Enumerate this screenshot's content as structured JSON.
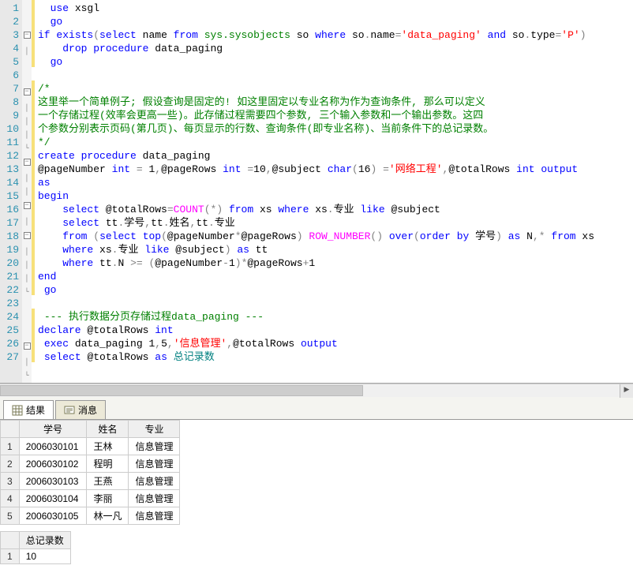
{
  "editor": {
    "lines": [
      {
        "n": 1,
        "fold": "",
        "mark": "y",
        "tokens": [
          [
            "",
            "  "
          ],
          [
            "kw",
            "use"
          ],
          [
            "",
            " xsgl"
          ]
        ]
      },
      {
        "n": 2,
        "fold": "",
        "mark": "y",
        "tokens": [
          [
            "",
            "  "
          ],
          [
            "kw",
            "go"
          ]
        ]
      },
      {
        "n": 3,
        "fold": "box",
        "mark": "y",
        "tokens": [
          [
            "kw",
            "if"
          ],
          [
            "",
            " "
          ],
          [
            "kw",
            "exists"
          ],
          [
            "op",
            "("
          ],
          [
            "kw",
            "select"
          ],
          [
            "",
            " name "
          ],
          [
            "kw",
            "from"
          ],
          [
            "",
            " "
          ],
          [
            "sys",
            "sys.sysobjects"
          ],
          [
            "",
            " so "
          ],
          [
            "kw",
            "where"
          ],
          [
            "",
            " so"
          ],
          [
            "op",
            "."
          ],
          [
            "",
            "name"
          ],
          [
            "op",
            "="
          ],
          [
            "str",
            "'data_paging'"
          ],
          [
            "",
            " "
          ],
          [
            "kw",
            "and"
          ],
          [
            "",
            " so"
          ],
          [
            "op",
            "."
          ],
          [
            "",
            "type"
          ],
          [
            "op",
            "="
          ],
          [
            "str",
            "'P'"
          ],
          [
            "op",
            ")"
          ]
        ]
      },
      {
        "n": 4,
        "fold": "bar",
        "mark": "y",
        "tokens": [
          [
            "",
            "    "
          ],
          [
            "kw",
            "drop"
          ],
          [
            "",
            " "
          ],
          [
            "kw",
            "procedure"
          ],
          [
            "",
            " data_paging"
          ]
        ]
      },
      {
        "n": 5,
        "fold": "",
        "mark": "y",
        "tokens": [
          [
            "",
            "  "
          ],
          [
            "kw",
            "go"
          ]
        ]
      },
      {
        "n": 6,
        "fold": "",
        "mark": "",
        "tokens": [
          [
            "",
            ""
          ]
        ]
      },
      {
        "n": 7,
        "fold": "box",
        "mark": "y",
        "tokens": [
          [
            "cmt",
            "/*"
          ]
        ]
      },
      {
        "n": 8,
        "fold": "bar",
        "mark": "y",
        "tokens": [
          [
            "cmt",
            "这里举一个简单例子; 假设查询是固定的! 如这里固定以专业名称为作为查询条件, 那么可以定义"
          ]
        ]
      },
      {
        "n": 9,
        "fold": "bar",
        "mark": "y",
        "tokens": [
          [
            "cmt",
            "一个存储过程(效率会更高一些)。此存储过程需要四个参数, 三个输入参数和一个输出参数。这四"
          ]
        ]
      },
      {
        "n": 10,
        "fold": "bar",
        "mark": "y",
        "tokens": [
          [
            "cmt",
            "个参数分别表示页码(第几页)、每页显示的行数、查询条件(即专业名称)、当前条件下的总记录数。"
          ]
        ]
      },
      {
        "n": 11,
        "fold": "end",
        "mark": "y",
        "tokens": [
          [
            "cmt",
            "*/"
          ]
        ]
      },
      {
        "n": 12,
        "fold": "box",
        "mark": "y",
        "tokens": [
          [
            "kw",
            "create"
          ],
          [
            "",
            " "
          ],
          [
            "kw",
            "procedure"
          ],
          [
            "",
            " data_paging"
          ]
        ]
      },
      {
        "n": 13,
        "fold": "bar",
        "mark": "y",
        "tokens": [
          [
            "var",
            "@pageNumber"
          ],
          [
            "",
            " "
          ],
          [
            "kw",
            "int"
          ],
          [
            "",
            " "
          ],
          [
            "op",
            "="
          ],
          [
            "",
            " 1"
          ],
          [
            "op",
            ","
          ],
          [
            "var",
            "@pageRows"
          ],
          [
            "",
            " "
          ],
          [
            "kw",
            "int"
          ],
          [
            "",
            " "
          ],
          [
            "op",
            "="
          ],
          [
            "",
            "10"
          ],
          [
            "op",
            ","
          ],
          [
            "var",
            "@subject"
          ],
          [
            "",
            " "
          ],
          [
            "kw",
            "char"
          ],
          [
            "op",
            "("
          ],
          [
            "",
            "16"
          ],
          [
            "op",
            ")"
          ],
          [
            "",
            " "
          ],
          [
            "op",
            "="
          ],
          [
            "str",
            "'网络工程'"
          ],
          [
            "op",
            ","
          ],
          [
            "var",
            "@totalRows"
          ],
          [
            "",
            " "
          ],
          [
            "kw",
            "int"
          ],
          [
            "",
            " "
          ],
          [
            "kw",
            "output"
          ]
        ]
      },
      {
        "n": 14,
        "fold": "bar",
        "mark": "y",
        "tokens": [
          [
            "kw",
            "as"
          ]
        ]
      },
      {
        "n": 15,
        "fold": "box",
        "mark": "y",
        "tokens": [
          [
            "kw",
            "begin"
          ]
        ]
      },
      {
        "n": 16,
        "fold": "bar",
        "mark": "y",
        "tokens": [
          [
            "",
            "    "
          ],
          [
            "kw",
            "select"
          ],
          [
            "",
            " "
          ],
          [
            "var",
            "@totalRows"
          ],
          [
            "op",
            "="
          ],
          [
            "fn",
            "COUNT"
          ],
          [
            "op",
            "("
          ],
          [
            "op",
            "*"
          ],
          [
            "op",
            ")"
          ],
          [
            "",
            " "
          ],
          [
            "kw",
            "from"
          ],
          [
            "",
            " xs "
          ],
          [
            "kw",
            "where"
          ],
          [
            "",
            " xs"
          ],
          [
            "op",
            "."
          ],
          [
            "",
            "专业 "
          ],
          [
            "kw",
            "like"
          ],
          [
            "",
            " "
          ],
          [
            "var",
            "@subject"
          ]
        ]
      },
      {
        "n": 17,
        "fold": "box",
        "mark": "y",
        "tokens": [
          [
            "",
            "    "
          ],
          [
            "kw",
            "select"
          ],
          [
            "",
            " tt"
          ],
          [
            "op",
            "."
          ],
          [
            "",
            "学号"
          ],
          [
            "op",
            ","
          ],
          [
            "",
            "tt"
          ],
          [
            "op",
            "."
          ],
          [
            "",
            "姓名"
          ],
          [
            "op",
            ","
          ],
          [
            "",
            "tt"
          ],
          [
            "op",
            "."
          ],
          [
            "",
            "专业"
          ]
        ]
      },
      {
        "n": 18,
        "fold": "bar",
        "mark": "y",
        "tokens": [
          [
            "",
            "    "
          ],
          [
            "kw",
            "from"
          ],
          [
            "",
            " "
          ],
          [
            "op",
            "("
          ],
          [
            "kw",
            "select"
          ],
          [
            "",
            " "
          ],
          [
            "kw",
            "top"
          ],
          [
            "op",
            "("
          ],
          [
            "var",
            "@pageNumber"
          ],
          [
            "op",
            "*"
          ],
          [
            "var",
            "@pageRows"
          ],
          [
            "op",
            ")"
          ],
          [
            "",
            " "
          ],
          [
            "fn",
            "ROW_NUMBER"
          ],
          [
            "op",
            "()"
          ],
          [
            "",
            " "
          ],
          [
            "kw",
            "over"
          ],
          [
            "op",
            "("
          ],
          [
            "kw",
            "order"
          ],
          [
            "",
            " "
          ],
          [
            "kw",
            "by"
          ],
          [
            "",
            " 学号"
          ],
          [
            "op",
            ")"
          ],
          [
            "",
            " "
          ],
          [
            "kw",
            "as"
          ],
          [
            "",
            " N"
          ],
          [
            "op",
            ","
          ],
          [
            "op",
            "*"
          ],
          [
            "",
            " "
          ],
          [
            "kw",
            "from"
          ],
          [
            "",
            " xs"
          ]
        ]
      },
      {
        "n": 19,
        "fold": "bar",
        "mark": "y",
        "tokens": [
          [
            "",
            "    "
          ],
          [
            "kw",
            "where"
          ],
          [
            "",
            " xs"
          ],
          [
            "op",
            "."
          ],
          [
            "",
            "专业 "
          ],
          [
            "kw",
            "like"
          ],
          [
            "",
            " "
          ],
          [
            "var",
            "@subject"
          ],
          [
            "op",
            ")"
          ],
          [
            "",
            " "
          ],
          [
            "kw",
            "as"
          ],
          [
            "",
            " tt"
          ]
        ]
      },
      {
        "n": 20,
        "fold": "bar",
        "mark": "y",
        "tokens": [
          [
            "",
            "    "
          ],
          [
            "kw",
            "where"
          ],
          [
            "",
            " tt"
          ],
          [
            "op",
            "."
          ],
          [
            "",
            "N "
          ],
          [
            "op",
            ">="
          ],
          [
            "",
            " "
          ],
          [
            "op",
            "("
          ],
          [
            "var",
            "@pageNumber"
          ],
          [
            "op",
            "-"
          ],
          [
            "",
            "1"
          ],
          [
            "op",
            ")"
          ],
          [
            "op",
            "*"
          ],
          [
            "var",
            "@pageRows"
          ],
          [
            "op",
            "+"
          ],
          [
            "",
            "1"
          ]
        ]
      },
      {
        "n": 21,
        "fold": "end",
        "mark": "y",
        "tokens": [
          [
            "kw",
            "end"
          ]
        ]
      },
      {
        "n": 22,
        "fold": "",
        "mark": "y",
        "tokens": [
          [
            "",
            " "
          ],
          [
            "kw",
            "go"
          ]
        ]
      },
      {
        "n": 23,
        "fold": "",
        "mark": "",
        "tokens": [
          [
            "",
            ""
          ]
        ]
      },
      {
        "n": 24,
        "fold": "",
        "mark": "y",
        "tokens": [
          [
            "",
            " "
          ],
          [
            "cmt",
            "--- 执行数据分页存储过程data_paging ---"
          ]
        ]
      },
      {
        "n": 25,
        "fold": "box",
        "mark": "y",
        "tokens": [
          [
            "kw",
            "declare"
          ],
          [
            "",
            " "
          ],
          [
            "var",
            "@totalRows"
          ],
          [
            "",
            " "
          ],
          [
            "kw",
            "int"
          ]
        ]
      },
      {
        "n": 26,
        "fold": "bar",
        "mark": "y",
        "tokens": [
          [
            "",
            " "
          ],
          [
            "kw",
            "exec"
          ],
          [
            "",
            " data_paging 1"
          ],
          [
            "op",
            ","
          ],
          [
            "",
            "5"
          ],
          [
            "op",
            ","
          ],
          [
            "str",
            "'信息管理'"
          ],
          [
            "op",
            ","
          ],
          [
            "var",
            "@totalRows"
          ],
          [
            "",
            " "
          ],
          [
            "kw",
            "output"
          ]
        ]
      },
      {
        "n": 27,
        "fold": "end",
        "mark": "y",
        "tokens": [
          [
            "",
            " "
          ],
          [
            "kw",
            "select"
          ],
          [
            "",
            " "
          ],
          [
            "var",
            "@totalRows"
          ],
          [
            "",
            " "
          ],
          [
            "kw",
            "as"
          ],
          [
            "",
            " "
          ],
          [
            "teal",
            "总记录数"
          ]
        ]
      }
    ]
  },
  "tabs": {
    "results": "结果",
    "messages": "消息"
  },
  "results": {
    "table1": {
      "headers": [
        "学号",
        "姓名",
        "专业"
      ],
      "rows": [
        [
          "2006030101",
          "王林",
          "信息管理"
        ],
        [
          "2006030102",
          "程明",
          "信息管理"
        ],
        [
          "2006030103",
          "王燕",
          "信息管理"
        ],
        [
          "2006030104",
          "李丽",
          "信息管理"
        ],
        [
          "2006030105",
          "林一凡",
          "信息管理"
        ]
      ]
    },
    "table2": {
      "headers": [
        "总记录数"
      ],
      "rows": [
        [
          "10"
        ]
      ]
    }
  }
}
